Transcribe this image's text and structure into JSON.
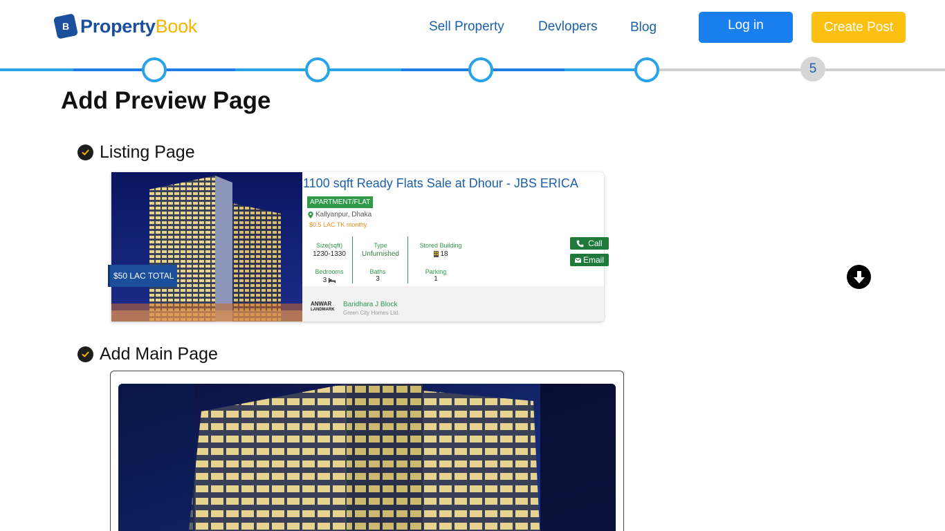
{
  "header": {
    "logo_mark": "B",
    "logo_part1": "Property",
    "logo_part2": "Book",
    "nav": [
      "Sell Property",
      "Devlopers",
      "Blog"
    ],
    "login_label": "Log in",
    "create_label": "Create Post"
  },
  "stepper": {
    "total_steps": 5,
    "completed_steps": 4,
    "current_step_label": "5"
  },
  "page_title": "Add Preview Page",
  "sections": {
    "listing_label": "Listing Page",
    "main_label": "Add Main Page"
  },
  "listing": {
    "price_tag": "$50 LAC TOTAL",
    "title": "1100 sqft Ready Flats Sale at Dhour - JBS ERICA",
    "type_badge": "APARTMENT/FLAT",
    "location": "Kallyanpur, Dhaka",
    "rent": "$0.5 LAC TK monthy",
    "stats": {
      "size_label": "Size(sqft)",
      "size_value": "1230-1330",
      "type_label": "Type",
      "type_value": "Unfurnished",
      "stored_label": "Stored Building",
      "stored_value": "18",
      "bedrooms_label": "Bedrooms",
      "bedrooms_value": "3",
      "baths_label": "Baths",
      "baths_value": "3",
      "parking_label": "Parking",
      "parking_value": "1"
    },
    "call_label": "Call",
    "email_label": "Email",
    "agent_logo_line1": "ANWAR",
    "agent_logo_line2": "LANDMARK",
    "agent_name": "Baridhara J Block",
    "agent_company": "Green City Homes Ltd."
  },
  "colors": {
    "brand_blue": "#1b4f9c",
    "brand_yellow": "#f5b400",
    "login_blue": "#1a7fee",
    "create_yellow": "#fdbf10",
    "step_blue": "#29a3e8",
    "green": "#2e9a4a"
  },
  "icons": [
    "check-circle-icon",
    "map-pin-icon",
    "phone-icon",
    "mail-icon",
    "building-icon",
    "bed-icon",
    "arrow-down-circle-icon"
  ]
}
